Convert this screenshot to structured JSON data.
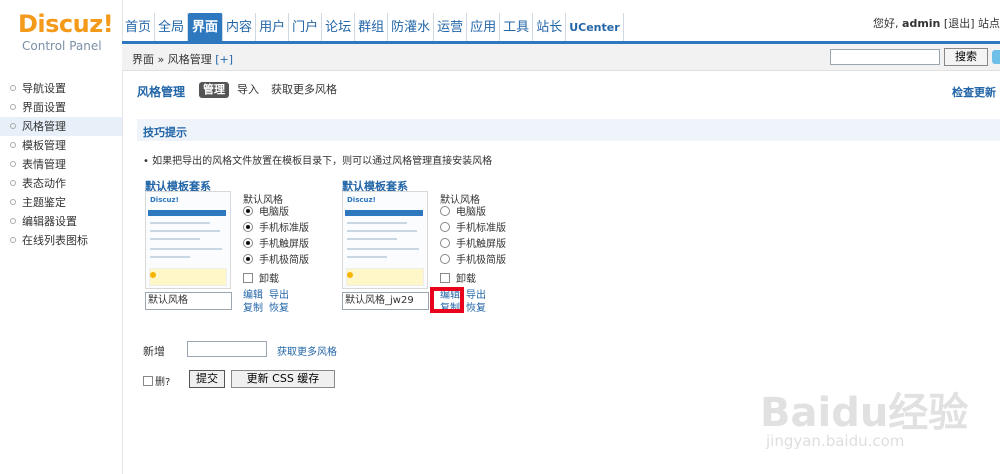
{
  "logo": {
    "brand": "Discuz!",
    "subtitle": "Control Panel"
  },
  "nav": {
    "items": [
      "首页",
      "全局",
      "界面",
      "内容",
      "用户",
      "门户",
      "论坛",
      "群组",
      "防灌水",
      "运营",
      "应用",
      "工具",
      "站长",
      "UCenter"
    ],
    "active": "界面"
  },
  "user": {
    "greeting": "您好,",
    "name": "admin",
    "logout": "[退出]",
    "site": "站点"
  },
  "breadcrumb": {
    "path": "界面 » 风格管理",
    "plus": "[+]"
  },
  "search": {
    "button": "搜索"
  },
  "sidebar": {
    "items": [
      {
        "label": "导航设置"
      },
      {
        "label": "界面设置"
      },
      {
        "label": "风格管理"
      },
      {
        "label": "模板管理"
      },
      {
        "label": "表情管理"
      },
      {
        "label": "表态动作"
      },
      {
        "label": "主题鉴定"
      },
      {
        "label": "编辑器设置"
      },
      {
        "label": "在线列表图标"
      }
    ],
    "active_index": 2
  },
  "main": {
    "title": "风格管理",
    "tabs": [
      "管理",
      "导入",
      "获取更多风格"
    ],
    "active_tab": "管理",
    "check_update": "检查更新",
    "tips_title": "技巧提示",
    "tip": "• 如果把导出的风格文件放置在模板目录下，则可以通过风格管理直接安装风格"
  },
  "styles": [
    {
      "set_name": "默认模板套系",
      "thumb_logo": "Discuz!",
      "style_name": "默认风格",
      "radio_title": "默认风格",
      "options": [
        {
          "label": "电脑版",
          "checked": true
        },
        {
          "label": "手机标准版",
          "checked": true
        },
        {
          "label": "手机触屏版",
          "checked": true
        },
        {
          "label": "手机极简版",
          "checked": true
        }
      ],
      "uninstall": "卸载",
      "ops": {
        "edit": "编辑",
        "export": "导出",
        "copy": "复制",
        "restore": "恢复"
      }
    },
    {
      "set_name": "默认模板套系",
      "thumb_logo": "Discuz!",
      "style_name": "默认风格_jw29",
      "radio_title": "默认风格",
      "options": [
        {
          "label": "电脑版",
          "checked": false
        },
        {
          "label": "手机标准版",
          "checked": false
        },
        {
          "label": "手机触屏版",
          "checked": false
        },
        {
          "label": "手机极简版",
          "checked": false
        }
      ],
      "uninstall": "卸载",
      "ops": {
        "edit": "编辑",
        "export": "导出",
        "copy": "复制",
        "restore": "恢复"
      }
    }
  ],
  "bottom": {
    "new_label": "新增",
    "more_link": "获取更多风格",
    "delete_label": "删?",
    "submit": "提交",
    "refresh_css": "更新 CSS 缓存"
  },
  "watermark": {
    "main": "Baidu经验",
    "sub": "jingyan.baidu.com"
  },
  "colors": {
    "accent": "#2e78c0",
    "logo": "#f49a1b",
    "highlight": "#e8001c"
  }
}
